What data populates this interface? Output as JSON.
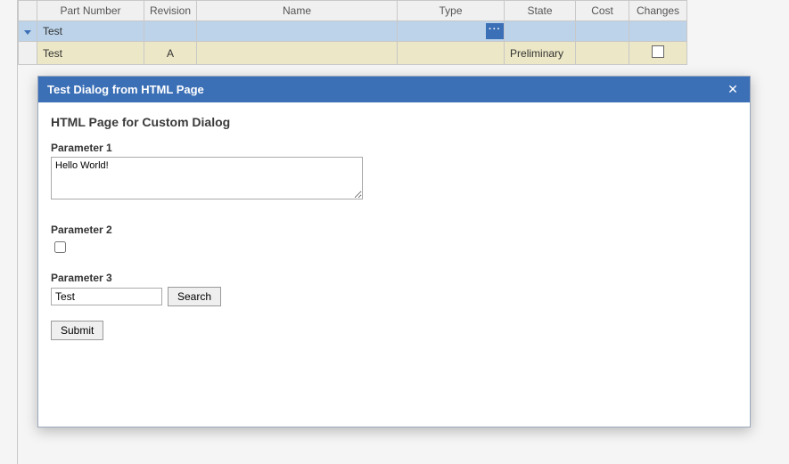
{
  "grid": {
    "headers": {
      "part_number": "Part Number",
      "revision": "Revision",
      "name": "Name",
      "type": "Type",
      "state": "State",
      "cost": "Cost",
      "changes": "Changes"
    },
    "rows": [
      {
        "part_number": "Test",
        "revision": "",
        "name": "",
        "type": "",
        "state": "",
        "cost": "",
        "show_ellipsis": true
      },
      {
        "part_number": "Test",
        "revision": "A",
        "name": "",
        "type": "",
        "state": "Preliminary",
        "cost": "",
        "show_checkbox": true
      }
    ]
  },
  "dialog": {
    "title": "Test Dialog from HTML Page",
    "heading": "HTML Page for Custom Dialog",
    "param1_label": "Parameter 1",
    "param1_value": "Hello World!",
    "param2_label": "Parameter 2",
    "param2_checked": false,
    "param3_label": "Parameter 3",
    "param3_value": "Test",
    "search_button": "Search",
    "submit_button": "Submit"
  }
}
